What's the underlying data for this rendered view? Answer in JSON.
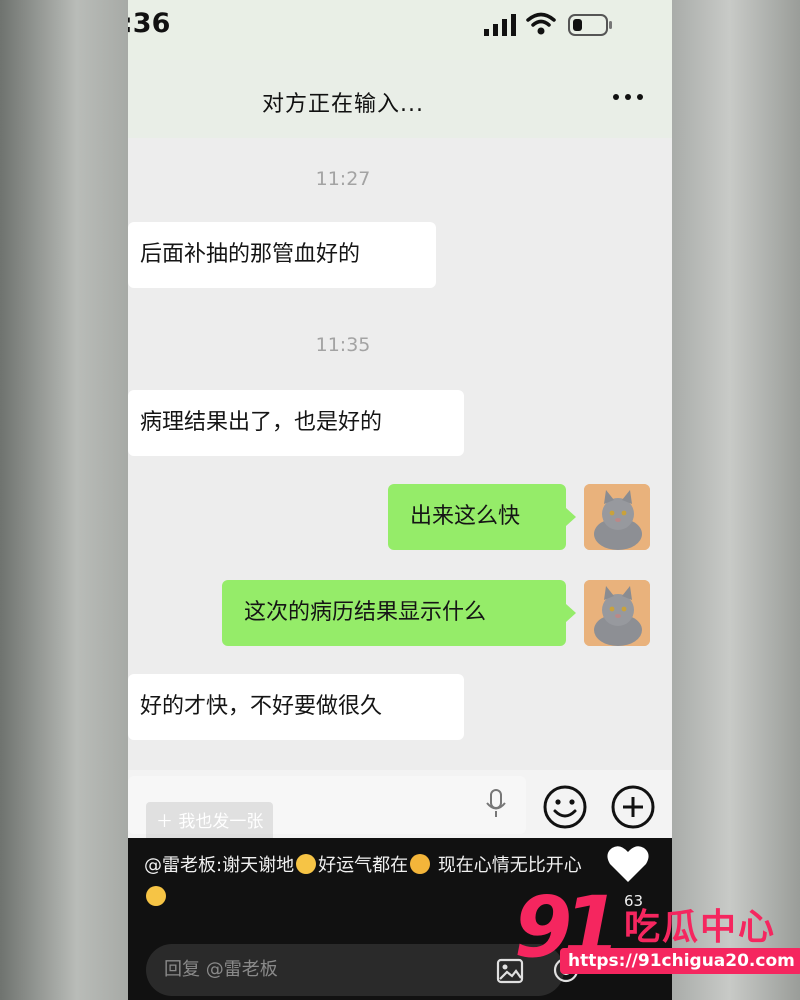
{
  "status_bar": {
    "time": ":36"
  },
  "nav": {
    "title": "对方正在输入..."
  },
  "messages": [
    {
      "type": "time",
      "text": "11:27"
    },
    {
      "type": "left",
      "text": "后面补抽的那管血好的"
    },
    {
      "type": "time",
      "text": "11:35"
    },
    {
      "type": "left",
      "text": "病理结果出了，也是好的"
    },
    {
      "type": "right",
      "text": "出来这么快"
    },
    {
      "type": "right",
      "text": "这次的病历结果显示什么"
    },
    {
      "type": "left",
      "text": "好的才快，不好要做很久"
    }
  ],
  "input": {
    "me_too_label": "＋ 我也发一张"
  },
  "comment": {
    "author": "@雷老板:",
    "part1": "谢天谢地",
    "part2": "好运气都在",
    "part3": "现在心情无比开心"
  },
  "likes": {
    "count": "63"
  },
  "reply": {
    "placeholder": "回复 @雷老板"
  },
  "watermark": {
    "number": "91",
    "text": "吃瓜中心",
    "url": "https://91chigua20.com"
  },
  "colors": {
    "bubble_right": "#95ec69",
    "bubble_left": "#ffffff",
    "watermark": "#f5265f"
  }
}
